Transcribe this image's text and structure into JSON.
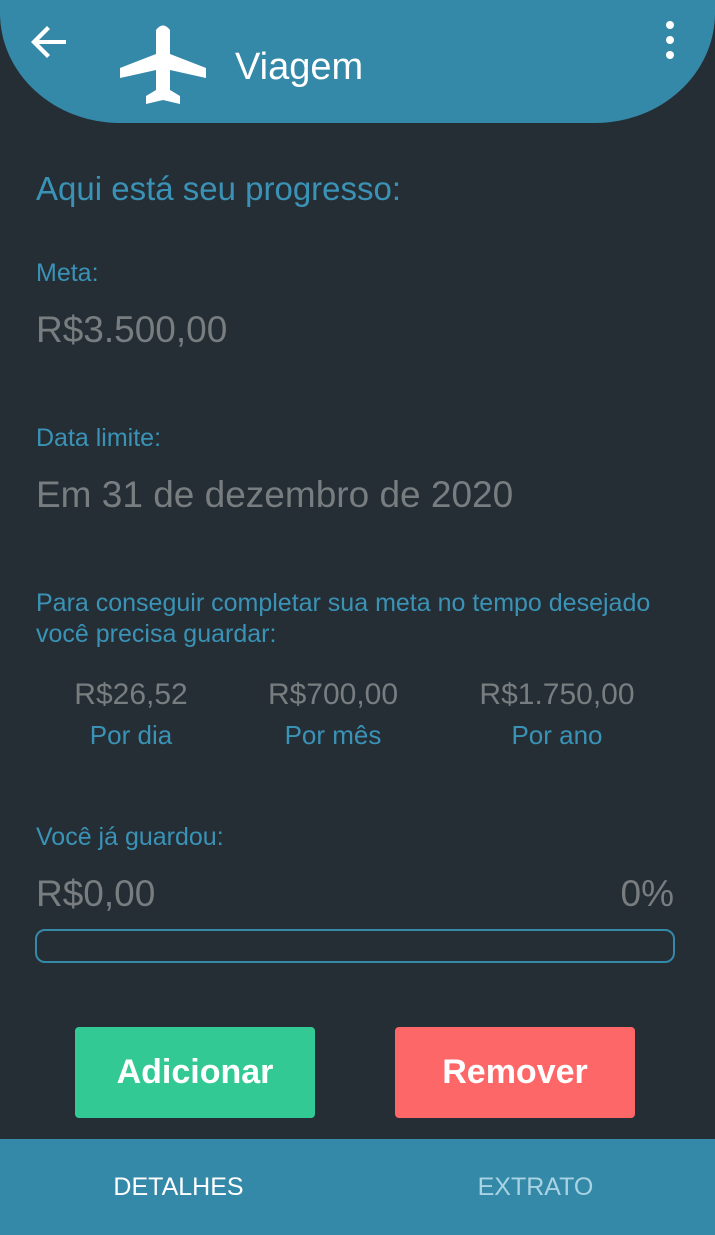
{
  "header": {
    "title": "Viagem",
    "back_icon": "arrow-left-icon",
    "category_icon": "airplane-icon",
    "menu_icon": "more-vert-icon"
  },
  "progress_section": {
    "heading": "Aqui está seu progresso:",
    "goal_label": "Meta:",
    "goal_value": "R$3.500,00",
    "deadline_label": "Data limite:",
    "deadline_value": "Em 31 de dezembro de 2020",
    "savings_info": "Para conseguir completar sua meta no tempo desejado você precisa guardar:",
    "savings_per_period": [
      {
        "value": "R$26,52",
        "label": "Por dia"
      },
      {
        "value": "R$700,00",
        "label": "Por mês"
      },
      {
        "value": "R$1.750,00",
        "label": "Por ano"
      }
    ],
    "saved_label": "Você já guardou:",
    "saved_value": "R$0,00",
    "saved_percent": "0%",
    "progress_fraction": 0
  },
  "actions": {
    "add_label": "Adicionar",
    "remove_label": "Remover"
  },
  "tabs": [
    {
      "label": "DETALHES",
      "active": true
    },
    {
      "label": "EXTRATO",
      "active": false
    }
  ],
  "colors": {
    "background": "#252e35",
    "header": "#3589a8",
    "accent_text": "#3a93b6",
    "value_text": "#787d80",
    "add_button": "#33c995",
    "remove_button": "#fe6768",
    "tab_active": "#ffffff",
    "tab_inactive": "#a8d3e2"
  }
}
